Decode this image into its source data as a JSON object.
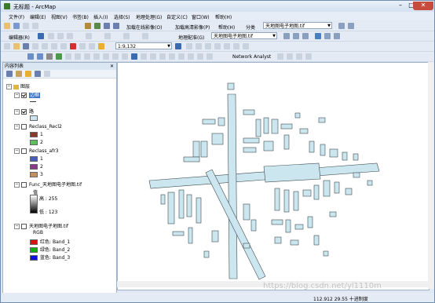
{
  "window": {
    "title": "无标题 - ArcMap"
  },
  "menu": [
    "文件(F)",
    "编辑(E)",
    "视图(V)",
    "书签(B)",
    "插入(I)",
    "选择(S)",
    "地理处理(G)",
    "自定义(C)",
    "窗口(W)",
    "帮助(H)"
  ],
  "toolbar": {
    "add_online_data": "加载在线影像(O)",
    "add_high_res": "加载高清影像(P)",
    "help_menu": "帮助(H)",
    "classify_label": "分类",
    "classify_layer": "天地图电子地图.tif",
    "editor": "编辑器(R)",
    "georef_label": "地理配准(G)",
    "georef_layer": "天地图电子地图.tif",
    "scale": "1:9,132",
    "network_analyst": "Network Analyst"
  },
  "toc": {
    "title": "内容列表",
    "layers_root": "图层",
    "items": [
      {
        "name": "边框",
        "checked": true
      },
      {
        "name": "路",
        "checked": true
      },
      {
        "name": "Reclass_Recl2",
        "checked": false,
        "classes": [
          {
            "label": "1",
            "color": "#8a3a2a"
          },
          {
            "label": "2",
            "color": "#5cc05c"
          }
        ]
      },
      {
        "name": "Reclass_afr3",
        "checked": false,
        "classes": [
          {
            "label": "1",
            "color": "#4a5cc0"
          },
          {
            "label": "2",
            "color": "#8a3a8a"
          },
          {
            "label": "3",
            "color": "#c09060"
          }
        ]
      },
      {
        "name": "Func_天地图电子地图.tif",
        "checked": false,
        "value_label": "值",
        "high": "高 : 255",
        "low": "低 : 123"
      },
      {
        "name": "天地图电子地图.tif",
        "checked": false,
        "rgb": "RGB",
        "bands": [
          {
            "label": "红色:",
            "band": "Band_1",
            "color": "#e01010"
          },
          {
            "label": "绿色:",
            "band": "Band_2",
            "color": "#10b010"
          },
          {
            "label": "蓝色:",
            "band": "Band_3",
            "color": "#1010e0"
          }
        ]
      }
    ]
  },
  "status": {
    "coords": "112.912  29.55 十进制度"
  },
  "watermark": "https://blog.csdn.net/yl1110m",
  "colors": {
    "map_fill": "#cbe6ee",
    "map_stroke": "#3f4b52",
    "accent": "#3b74c8"
  }
}
